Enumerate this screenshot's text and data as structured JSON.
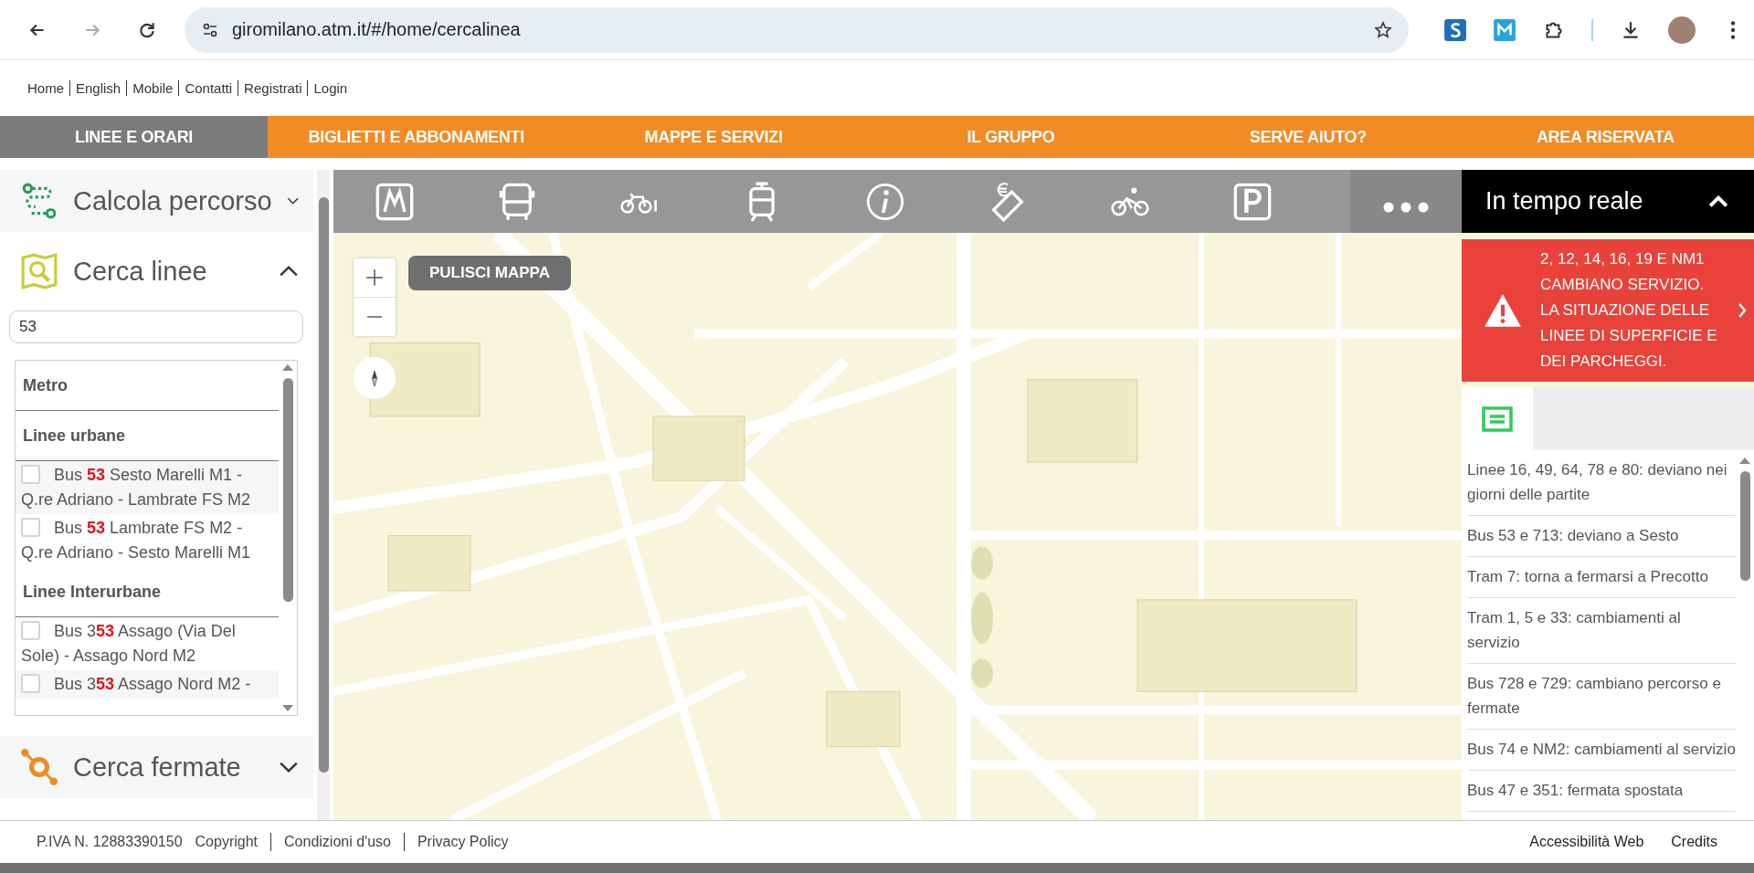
{
  "browser": {
    "url": "giromilano.atm.it/#/home/cercalinea"
  },
  "top_links": [
    "Home",
    "English",
    "Mobile",
    "Contatti",
    "Registrati",
    "Login"
  ],
  "nav": [
    {
      "label": "LINEE E ORARI",
      "selected": true
    },
    {
      "label": "BIGLIETTI E ABBONAMENTI",
      "selected": false
    },
    {
      "label": "MAPPE E SERVIZI",
      "selected": false
    },
    {
      "label": "IL GRUPPO",
      "selected": false
    },
    {
      "label": "SERVE AIUTO?",
      "selected": false
    },
    {
      "label": "AREA RISERVATA",
      "selected": false
    }
  ],
  "sidebar": {
    "sections": [
      {
        "kind": "route",
        "title": "Calcola percorso",
        "expanded": false
      },
      {
        "kind": "lines",
        "title": "Cerca linee",
        "expanded": true,
        "search": {
          "value": "53"
        },
        "groups": [
          {
            "title": "Metro"
          },
          {
            "title": "Linee urbane",
            "items": [
              {
                "text": "Bus **53** Sesto Marelli M1 - Q.re Adriano - Lambrate FS M2",
                "checked": false
              },
              {
                "text": "Bus **53** Lambrate FS M2 - Q.re Adriano - Sesto Marelli M1",
                "checked": false
              }
            ]
          },
          {
            "title": "Linee Interurbane",
            "items": [
              {
                "text": "Bus 3**53** Assago (Via Del Sole) - Assago Nord M2",
                "checked": false
              },
              {
                "text": "Bus 3**53** Assago Nord M2 -",
                "checked": false
              }
            ]
          }
        ]
      },
      {
        "kind": "stops",
        "title": "Cerca fermate",
        "expanded": false
      }
    ]
  },
  "map": {
    "clear_button": "PULISCI MAPPA"
  },
  "realtime": {
    "title": "In tempo reale",
    "expanded": true,
    "alert": "2, 12, 14, 16, 19 E NM1 CAMBIANO SERVIZIO. LA SITUAZIONE DELLE LINEE DI SUPERFICIE E DEI PARCHEGGI.",
    "tabs": [
      {
        "selected": true
      }
    ],
    "news": [
      "Linee 16, 49, 64, 78 e 80: deviano nei giorni delle partite",
      "Bus 53 e 713: deviano a Sesto",
      "Tram 7: torna a fermarsi a Precotto",
      "Tram 1, 5 e 33: cambiamenti al servizio",
      "Bus 728 e 729: cambiano percorso e fermate",
      "Bus 74 e NM2: cambiamenti al servizio",
      "Bus 47 e 351: fermata spostata"
    ]
  },
  "footer": {
    "left": [
      "P.IVA N. 12883390150",
      "Copyright",
      "Condizioni d'uso",
      "Privacy Policy"
    ],
    "right": [
      "Accessibilità Web",
      "Credits"
    ]
  }
}
